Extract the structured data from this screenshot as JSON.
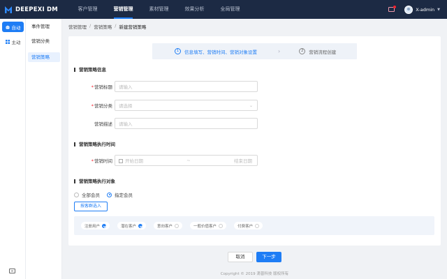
{
  "app": {
    "logo_text": "DEEPEXI DM"
  },
  "nav": [
    {
      "label": "客户管理",
      "active": false
    },
    {
      "label": "营销管理",
      "active": true
    },
    {
      "label": "素材管理",
      "active": false
    },
    {
      "label": "效果分析",
      "active": false
    },
    {
      "label": "全局管理",
      "active": false
    }
  ],
  "user": {
    "name": "X-admin"
  },
  "rail": [
    {
      "label": "自动",
      "icon": "robot-icon",
      "active": true
    },
    {
      "label": "主动",
      "icon": "grid-icon",
      "active": false
    }
  ],
  "submenu": [
    {
      "label": "事件管理",
      "active": false
    },
    {
      "label": "营销分类",
      "active": false
    },
    {
      "label": "营销策略",
      "active": true
    }
  ],
  "breadcrumb": [
    "营销管理",
    "营销策略",
    "新建营销策略"
  ],
  "steps": [
    {
      "num": "1",
      "label": "信息填写、营销时间、营销对象设置",
      "active": true
    },
    {
      "num": "2",
      "label": "营销流程创建",
      "active": false
    }
  ],
  "sections": {
    "info": "营销策略信息",
    "time": "营销策略执行时间",
    "target": "营销策略执行对象"
  },
  "form": {
    "title_label": "营销标题",
    "title_placeholder": "请输入",
    "category_label": "营销分类",
    "category_placeholder": "请选择",
    "desc_label": "营销描述",
    "desc_placeholder": "请输入",
    "time_label": "营销时间",
    "start_placeholder": "开始日期",
    "end_placeholder": "结束日期"
  },
  "audience": {
    "options": [
      {
        "label": "全部会员",
        "selected": false
      },
      {
        "label": "指定会员",
        "selected": true
      }
    ],
    "filter_button": "按客群选入",
    "tags": [
      {
        "label": "注册用户",
        "checked": true
      },
      {
        "label": "潜在客户",
        "checked": true
      },
      {
        "label": "意向客户",
        "checked": false
      },
      {
        "label": "一般价值客户",
        "checked": false
      },
      {
        "label": "付费客户",
        "checked": false
      }
    ]
  },
  "actions": {
    "cancel": "取消",
    "next": "下一步"
  },
  "footer": {
    "copyright": "Copyright © 2019 滴普科技 版权所有"
  },
  "colors": {
    "primary": "#1e7df5",
    "topbar": "#1c2a44"
  }
}
